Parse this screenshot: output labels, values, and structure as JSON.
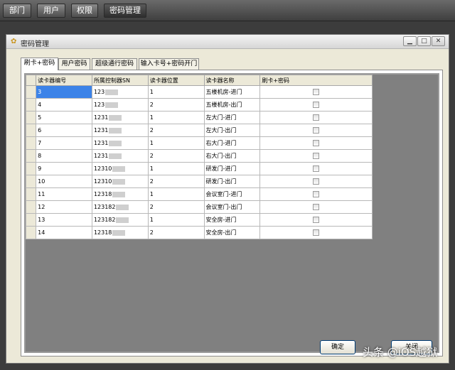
{
  "topnav": [
    "部门",
    "用户",
    "权限",
    "密码管理"
  ],
  "window": {
    "title": "密码管理"
  },
  "tabs": [
    "刷卡+密码",
    "用户密码",
    "超级通行密码",
    "输入卡号+密码开门"
  ],
  "table": {
    "headers": [
      "读卡器编号",
      "所属控制器SN",
      "读卡器位置",
      "读卡器名称",
      "刷卡+密码"
    ],
    "rows": [
      {
        "id": "3",
        "sn": "123",
        "pos": "1",
        "name": "五楼机房-进门"
      },
      {
        "id": "4",
        "sn": "123",
        "pos": "2",
        "name": "五楼机房-出门"
      },
      {
        "id": "5",
        "sn": "1231",
        "pos": "1",
        "name": "左大门-进门"
      },
      {
        "id": "6",
        "sn": "1231",
        "pos": "2",
        "name": "左大门-出门"
      },
      {
        "id": "7",
        "sn": "1231",
        "pos": "1",
        "name": "右大门-进门"
      },
      {
        "id": "8",
        "sn": "1231",
        "pos": "2",
        "name": "右大门-出门"
      },
      {
        "id": "9",
        "sn": "12310",
        "pos": "1",
        "name": "研发门-进门"
      },
      {
        "id": "10",
        "sn": "12310",
        "pos": "2",
        "name": "研发门-出门"
      },
      {
        "id": "11",
        "sn": "12318",
        "pos": "1",
        "name": "会议室门-进门"
      },
      {
        "id": "12",
        "sn": "123182",
        "pos": "2",
        "name": "会议室门-出门"
      },
      {
        "id": "13",
        "sn": "123182",
        "pos": "1",
        "name": "安全房-进门"
      },
      {
        "id": "14",
        "sn": "12318",
        "pos": "2",
        "name": "安全房-出门"
      }
    ]
  },
  "buttons": {
    "ok": "确定",
    "close": "关闭"
  },
  "watermark": "头条 @iOS越狱"
}
